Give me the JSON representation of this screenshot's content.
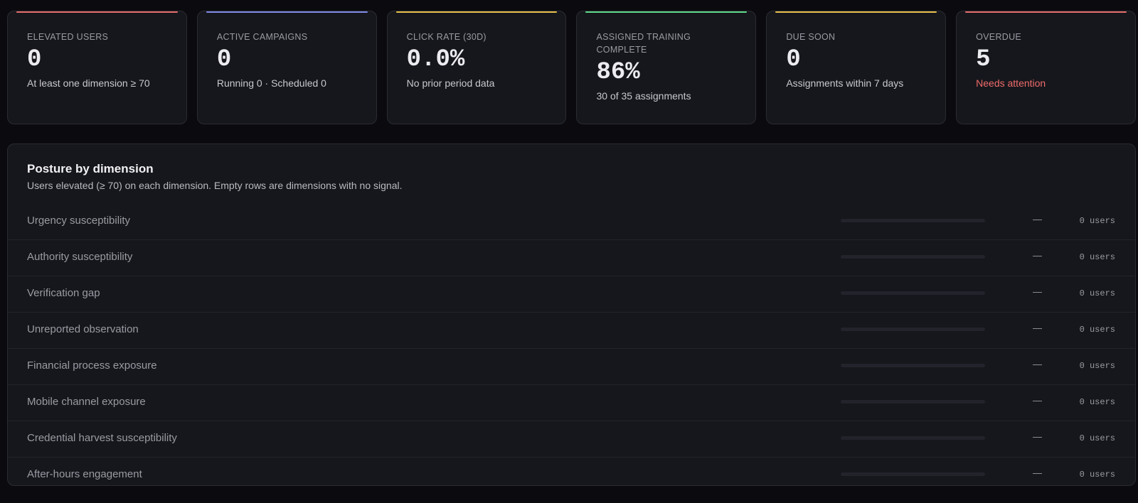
{
  "kpis": [
    {
      "label": "ELEVATED USERS",
      "value": "0",
      "sub": "At least one dimension ≥ 70",
      "accent": "#e56b6b",
      "alert": false
    },
    {
      "label": "ACTIVE CAMPAIGNS",
      "value": "0",
      "sub": "Running 0 · Scheduled 0",
      "accent": "#7f8ae6",
      "alert": false
    },
    {
      "label": "CLICK RATE (30D)",
      "value": "0.0%",
      "sub": "No prior period data",
      "accent": "#e6c04a",
      "alert": false
    },
    {
      "label": "ASSIGNED TRAINING COMPLETE",
      "value": "86%",
      "sub": "30 of 35 assignments",
      "accent": "#5fd98a",
      "alert": false
    },
    {
      "label": "DUE SOON",
      "value": "0",
      "sub": "Assignments within 7 days",
      "accent": "#e6c04a",
      "alert": false
    },
    {
      "label": "OVERDUE",
      "value": "5",
      "sub": "Needs attention",
      "accent": "#e56b6b",
      "alert": true
    }
  ],
  "posture": {
    "title": "Posture by dimension",
    "description": "Users elevated (≥ 70) on each dimension. Empty rows are dimensions with no signal.",
    "rows": [
      {
        "name": "Urgency susceptibility",
        "level": 0,
        "score": "—",
        "users": "0 users"
      },
      {
        "name": "Authority susceptibility",
        "level": 0,
        "score": "—",
        "users": "0 users"
      },
      {
        "name": "Verification gap",
        "level": 0,
        "score": "—",
        "users": "0 users"
      },
      {
        "name": "Unreported observation",
        "level": 0,
        "score": "—",
        "users": "0 users"
      },
      {
        "name": "Financial process exposure",
        "level": 0,
        "score": "—",
        "users": "0 users"
      },
      {
        "name": "Mobile channel exposure",
        "level": 0,
        "score": "—",
        "users": "0 users"
      },
      {
        "name": "Credential harvest susceptibility",
        "level": 0,
        "score": "—",
        "users": "0 users"
      },
      {
        "name": "After-hours engagement",
        "level": 0,
        "score": "—",
        "users": "0 users"
      }
    ]
  }
}
